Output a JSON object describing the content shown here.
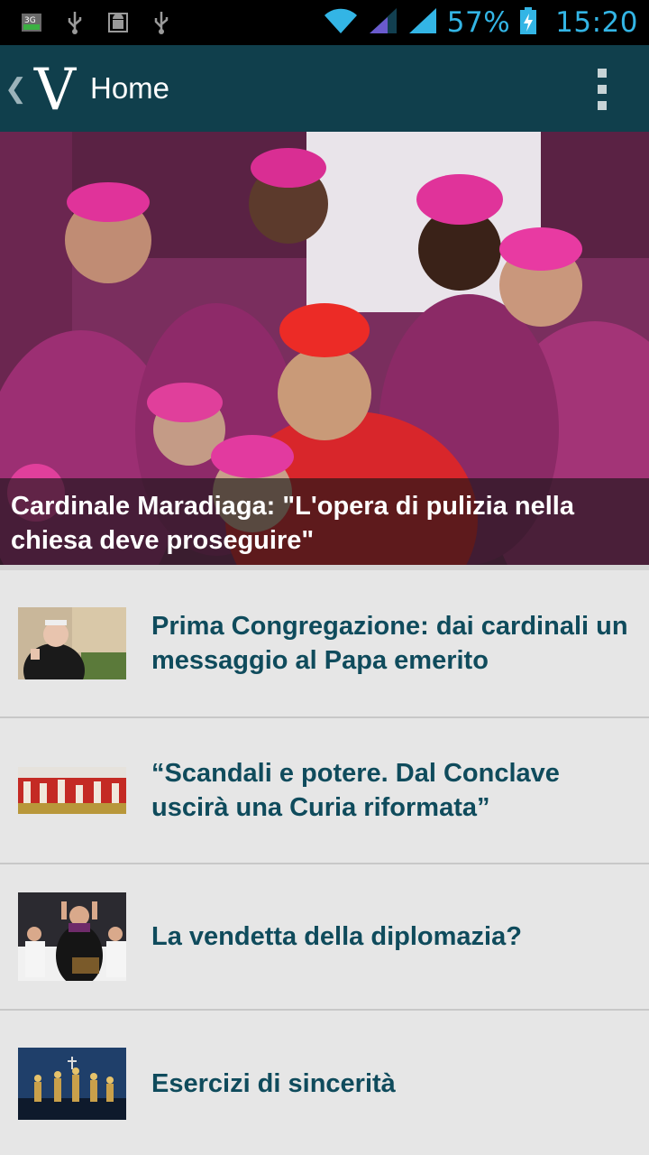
{
  "status_bar": {
    "battery": "57%",
    "time": "15:20",
    "icons": [
      "3g-data-icon",
      "usb-icon",
      "android-debug-icon",
      "usb-icon",
      "wifi-icon",
      "signal-icon",
      "signal-icon",
      "battery-charging-icon"
    ]
  },
  "action_bar": {
    "logo_letter": "V",
    "title": "Home",
    "back_icon": "chevron-left-icon",
    "menu_icon": "overflow-menu-icon"
  },
  "hero": {
    "caption": "Cardinale Maradiaga: \"L'opera di pulizia nella chiesa deve proseguire\""
  },
  "articles": [
    {
      "title": "Prima Congregazione: dai cardinali un messaggio al Papa emerito"
    },
    {
      "title": "“Scandali e potere. Dal Conclave uscirà una Curia riformata”"
    },
    {
      "title": "La vendetta della diplomazia?"
    },
    {
      "title": "Esercizi di sincerità"
    }
  ],
  "colors": {
    "action_bar": "#103f4c",
    "article_title": "#0f4b5c",
    "status_accent": "#33b5e5",
    "list_background": "#e6e6e6"
  }
}
